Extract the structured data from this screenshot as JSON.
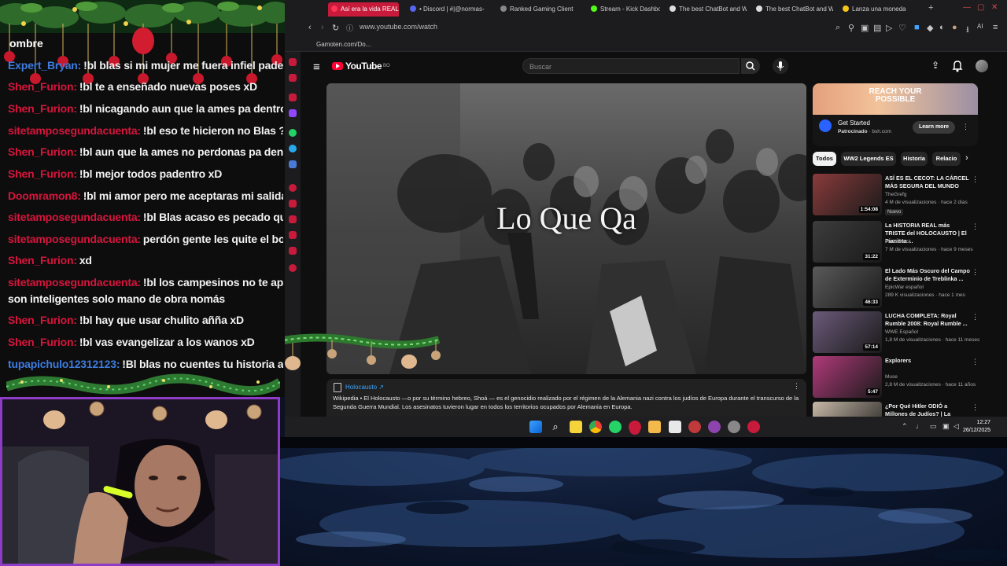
{
  "chat": {
    "header": "ombre",
    "messages": [
      {
        "user": "Expert_Bryan:",
        "text": "!bl blas si mi mujer me fuera infiel padentro no",
        "color": "blue"
      },
      {
        "user": "Shen_Furion:",
        "text": "!bl te a enseñado nuevas poses xD",
        "color": "red"
      },
      {
        "user": "Shen_Furion:",
        "text": "!bl nicagando aun que la ames pa dentro xD",
        "color": "red"
      },
      {
        "user": "sitetamposegundacuenta:",
        "text": "!bl eso te hicieron no Blas ?",
        "color": "red"
      },
      {
        "user": "Shen_Furion:",
        "text": "!bl aun que la ames no perdonas pa dentro xD",
        "color": "red"
      },
      {
        "user": "Shen_Furion:",
        "text": "!bl mejor todos padentro xD",
        "color": "red"
      },
      {
        "user": "Doomramon8:",
        "text": "!bl mi amor pero me aceptaras mi salida mi am",
        "color": "red"
      },
      {
        "user": "sitetamposegundacuenta:",
        "text": "!bl Blas acaso es pecado que te ar",
        "color": "red"
      },
      {
        "user": "sitetamposegundacuenta:",
        "text": "perdón gente les quite el bot",
        "color": "red"
      },
      {
        "user": "Shen_Furion:",
        "text": "xd",
        "color": "red"
      },
      {
        "user": "sitetamposegundacuenta:",
        "text": "!bl los campesinos no te apoyarían",
        "color": "red"
      },
      {
        "user": "",
        "text": "son inteligentes solo mano de obra nomás",
        "color": "red"
      },
      {
        "user": "Shen_Furion:",
        "text": "!bl hay que usar chulito añña xD",
        "color": "red"
      },
      {
        "user": "Shen_Furion:",
        "text": "!bl vas evangelizar a los wanos xD",
        "color": "red"
      },
      {
        "user": "tupapichulo12312123:",
        "text": "!Bl blas no cuentes tu historia aver",
        "color": "blue"
      }
    ]
  },
  "browser": {
    "tabs": [
      {
        "label": "Así era la vida REAL de lo",
        "active": true,
        "color": "#ff3355"
      },
      {
        "label": "• Discord | #|@normas-",
        "active": false,
        "color": "#5865f2"
      },
      {
        "label": "Ranked Gaming Client",
        "active": false,
        "color": "#888888"
      },
      {
        "label": "Stream - Kick Dashboard",
        "active": false,
        "color": "#53fc18"
      },
      {
        "label": "The best ChatBot and W",
        "active": false,
        "color": "#dddddd"
      },
      {
        "label": "The best ChatBot and W",
        "active": false,
        "color": "#dddddd"
      },
      {
        "label": "Lanza una moneda",
        "active": false,
        "color": "#f5c518"
      }
    ],
    "url": "www.youtube.com/watch",
    "bookmark": "Gamoten.com/Do..."
  },
  "youtube": {
    "logo": "YouTube",
    "logo_sup": "BO",
    "search_placeholder": "Buscar",
    "caption": "Lo Que Qa",
    "wiki": {
      "title": "Holocausto ↗",
      "text": "Wikipedia • El Holocausto —o por su término hebreo, Shoá — es el genocidio realizado por el régimen de la Alemania nazi contra los judíos de Europa durante el transcurso de la Segunda Guerra Mundial. Los asesinatos tuvieron lugar en todos los territorios ocupados por Alemania en Europa."
    },
    "ad": {
      "headline": "REACH YOUR POSSIBLE",
      "title": "Get Started",
      "sponsor_label": "Patrocinado",
      "sponsor_domain": "bsh.com",
      "button": "Learn more"
    },
    "chips": [
      "Todos",
      "WW2 Legends ES",
      "Historia",
      "Relacio"
    ],
    "recommendations": [
      {
        "title": "ASÍ ES EL CECOT: LA CÁRCEL MÁS SEGURA DEL MUNDO",
        "channel": "TheGrefg",
        "meta": "4 M de visualizaciones · hace 2 días",
        "duration": "1:54:08",
        "badge": "Nuevo",
        "thumb": "#8a3b3b"
      },
      {
        "title": "La HISTORIA REAL más TRISTE del HOLOCAUSTO | El Pianista ...",
        "channel": "Farid Dieck",
        "meta": "7 M de visualizaciones · hace 9 meses",
        "duration": "31:22",
        "badge": "",
        "thumb": "#3d3d3d"
      },
      {
        "title": "El Lado Más Oscuro del Campo de Exterminio de Treblinka ...",
        "channel": "EpicWar español",
        "meta": "289 K visualizaciones · hace 1 mes",
        "duration": "46:33",
        "badge": "",
        "thumb": "#5a5a5a"
      },
      {
        "title": "LUCHA COMPLETA: Royal Rumble 2008: Royal Rumble ...",
        "channel": "WWE Español",
        "meta": "1,8 M de visualizaciones · hace 11 meses",
        "duration": "57:14",
        "badge": "",
        "thumb": "#6b5a7a"
      },
      {
        "title": "Explorers",
        "channel": "Muse",
        "meta": "2,8 M de visualizaciones · hace 11 años",
        "duration": "5:47",
        "badge": "",
        "thumb": "#b03a7a"
      },
      {
        "title": "¿Por Qué Hitler ODIÓ a Millones de Judíos? | La OSCURA Verdad",
        "channel": "",
        "meta": "",
        "duration": "",
        "badge": "",
        "thumb": "#c7b9a8"
      }
    ]
  },
  "taskbar": {
    "time": "12:27",
    "date": "26/12/2025"
  }
}
